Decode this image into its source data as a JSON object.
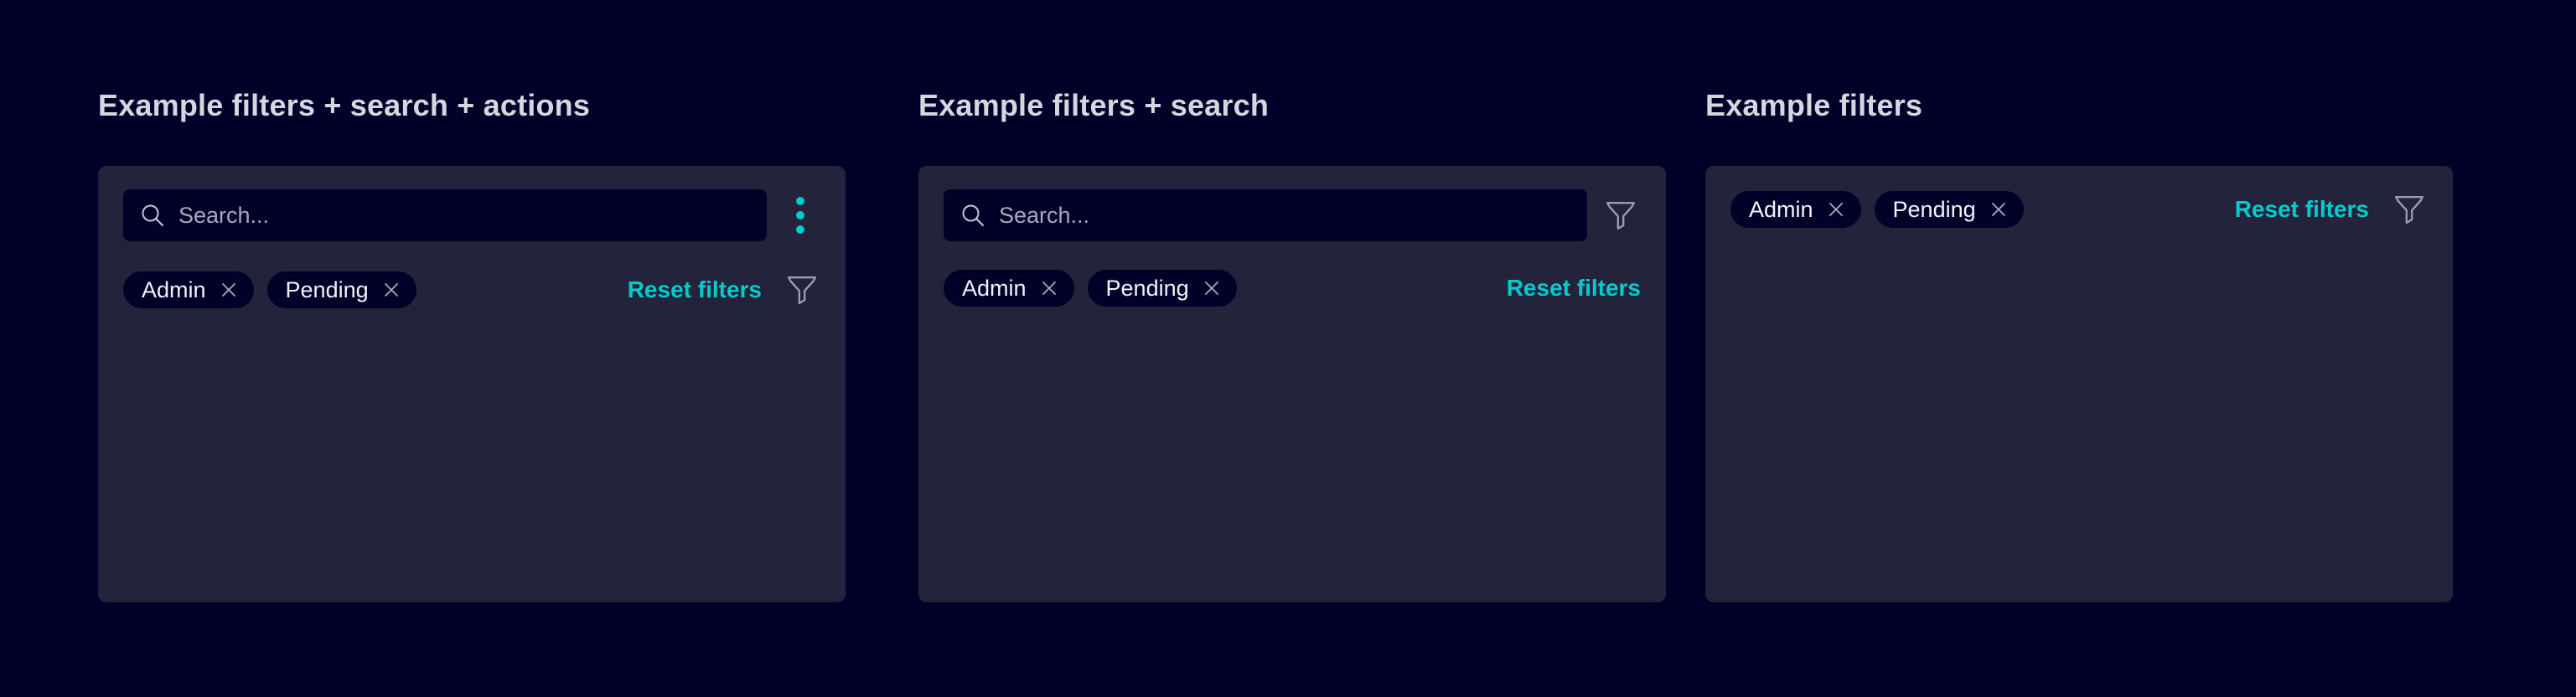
{
  "colors": {
    "page_background": "#000028",
    "panel_background": "#23233c",
    "field_background": "#000028",
    "accent": "#00cccc",
    "title_text": "#d6d6e1",
    "body_text": "#f3f3f7",
    "placeholder_text": "#a8a8bb",
    "icon_gray": "#9d9daf"
  },
  "search": {
    "placeholder": "Search...",
    "value": ""
  },
  "icons": {
    "search": "magnifier-icon",
    "kebab": "vertical-dots-menu-icon",
    "funnel": "filter-funnel-icon",
    "chip_close": "x-close-icon"
  },
  "panels": [
    {
      "title": "Example filters + search + actions",
      "reset_filters_label": "Reset filters",
      "chips": [
        {
          "label": "Admin"
        },
        {
          "label": "Pending"
        }
      ]
    },
    {
      "title": "Example filters + search",
      "reset_filters_label": "Reset filters",
      "chips": [
        {
          "label": "Admin"
        },
        {
          "label": "Pending"
        }
      ]
    },
    {
      "title": "Example filters",
      "reset_filters_label": "Reset filters",
      "chips": [
        {
          "label": "Admin"
        },
        {
          "label": "Pending"
        }
      ]
    }
  ]
}
